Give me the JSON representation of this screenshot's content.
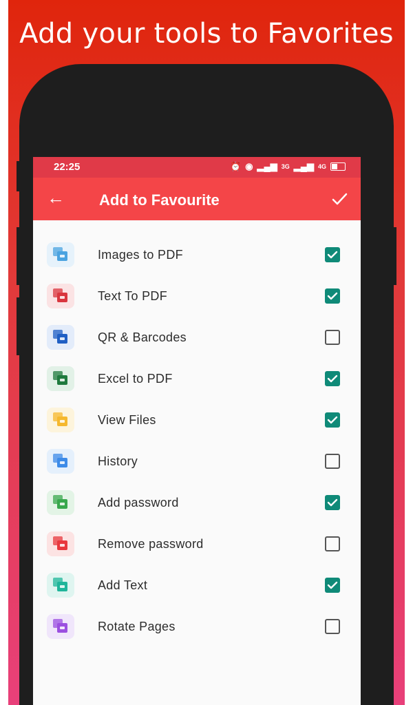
{
  "promo": {
    "headline": "Add your tools to Favorites"
  },
  "status_bar": {
    "time": "22:25",
    "network_3g": "3G",
    "network_4g": "4G"
  },
  "app_bar": {
    "title": "Add to Favourite",
    "back_icon": "arrow-left-icon",
    "confirm_icon": "check-icon"
  },
  "colors": {
    "accent": "#f44548",
    "status_bar": "#e03a48",
    "checkbox_checked": "#0f8a78"
  },
  "tools": [
    {
      "label": "Images to PDF",
      "checked": true,
      "icon": "image-file-icon",
      "icon_color": "#4aa3e0",
      "tile_color": "#e6f2fb"
    },
    {
      "label": "Text To PDF",
      "checked": true,
      "icon": "text-file-icon",
      "icon_color": "#d9363e",
      "tile_color": "#fbe3e4"
    },
    {
      "label": "QR & Barcodes",
      "checked": false,
      "icon": "qr-file-icon",
      "icon_color": "#1f5fc4",
      "tile_color": "#e3ecfa"
    },
    {
      "label": "Excel to PDF",
      "checked": true,
      "icon": "excel-file-icon",
      "icon_color": "#1f7a3e",
      "tile_color": "#e2f1e7"
    },
    {
      "label": "View Files",
      "checked": true,
      "icon": "view-file-icon",
      "icon_color": "#f5b82e",
      "tile_color": "#fdf4dc"
    },
    {
      "label": "History",
      "checked": false,
      "icon": "history-file-icon",
      "icon_color": "#3d8be8",
      "tile_color": "#e5f0fc"
    },
    {
      "label": "Add password",
      "checked": true,
      "icon": "lock-file-icon",
      "icon_color": "#39a84d",
      "tile_color": "#e3f4e6"
    },
    {
      "label": "Remove password",
      "checked": false,
      "icon": "unlock-file-icon",
      "icon_color": "#e8383e",
      "tile_color": "#fce3e3"
    },
    {
      "label": "Add Text",
      "checked": true,
      "icon": "add-text-file-icon",
      "icon_color": "#1fb59a",
      "tile_color": "#dff5f0"
    },
    {
      "label": "Rotate Pages",
      "checked": false,
      "icon": "rotate-file-icon",
      "icon_color": "#9b4fe0",
      "tile_color": "#f0e6fb"
    }
  ]
}
